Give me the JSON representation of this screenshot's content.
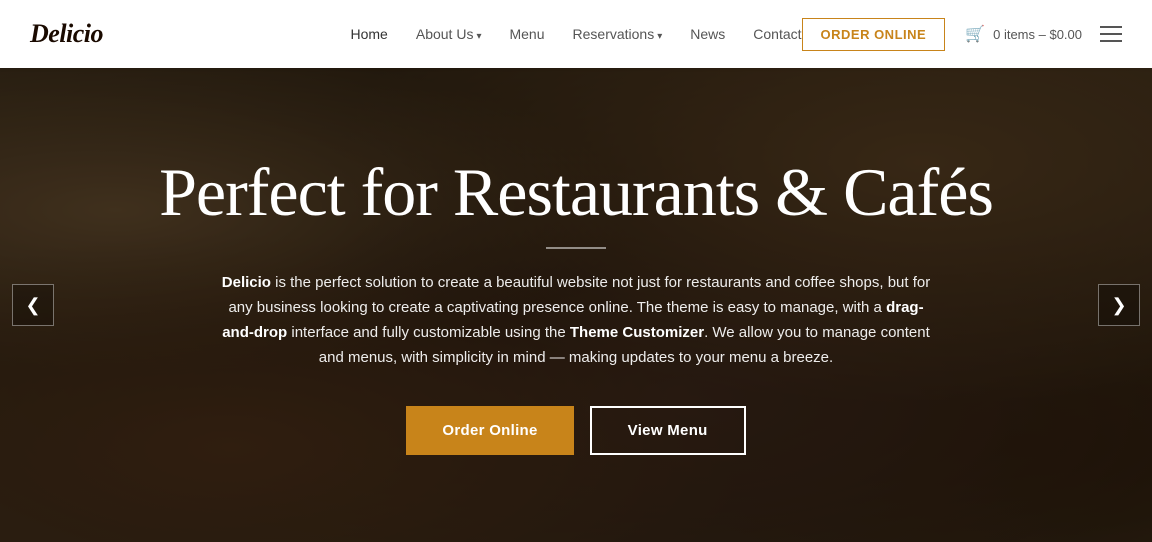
{
  "header": {
    "logo": "Delicio",
    "nav": {
      "home": "Home",
      "about_us": "About Us",
      "menu": "Menu",
      "reservations": "Reservations",
      "news": "News",
      "contact": "Contact"
    },
    "order_online_btn": "ORDER ONLINE",
    "cart": {
      "label": "0 items – $0.00"
    }
  },
  "hero": {
    "title": "Perfect for Restaurants & Cafés",
    "description_part1": " is the perfect solution to create a beautiful website not just for restaurants and coffee shops, but for any business looking to create a captivating presence online. The theme is easy to manage, with a ",
    "drag_drop": "drag-and-drop",
    "description_part2": " interface and fully customizable using the ",
    "theme_customizer": "Theme Customizer",
    "description_part3": ". We allow you to manage content and menus, with simplicity in mind — making updates to your menu a breeze.",
    "brand_name": "Delicio",
    "btn_order": "Order Online",
    "btn_menu": "View Menu"
  },
  "icons": {
    "cart": "🛒",
    "chevron_down": "▾",
    "hamburger": "≡",
    "arrow_left": "❮",
    "arrow_right": "❯"
  },
  "colors": {
    "accent": "#c8841a",
    "logo_color": "#1a0a00",
    "nav_active": "#333",
    "nav_inactive": "#777"
  }
}
